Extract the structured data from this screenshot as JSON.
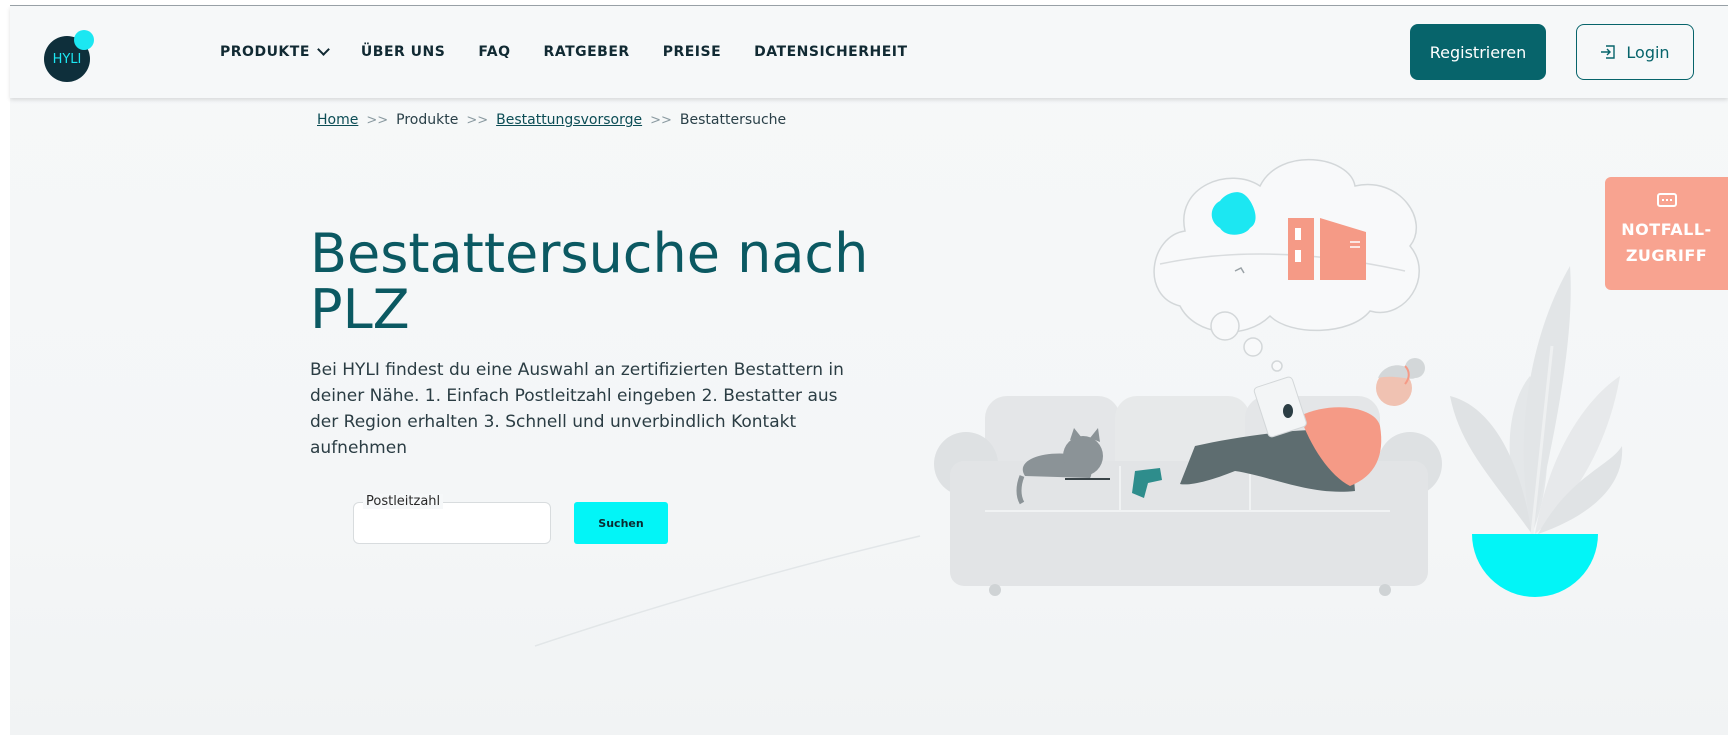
{
  "brand": {
    "logo_text": "HYLI"
  },
  "nav": {
    "items": [
      {
        "label": "PRODUKTE",
        "has_dropdown": true
      },
      {
        "label": "ÜBER UNS"
      },
      {
        "label": "FAQ"
      },
      {
        "label": "RATGEBER"
      },
      {
        "label": "PREISE"
      },
      {
        "label": "DATENSICHERHEIT"
      }
    ]
  },
  "header": {
    "register_label": "Registrieren",
    "login_label": "Login"
  },
  "breadcrumb": {
    "items": [
      "Home",
      "Produkte",
      "Bestattungsvorsorge",
      "Bestattersuche"
    ],
    "separator": ">>"
  },
  "main": {
    "title": "Bestattersuche nach PLZ",
    "intro": "Bei HYLI findest du eine Auswahl an zertifizierten Bestattern in deiner Nähe. 1. Einfach Postleitzahl eingeben 2. Bestatter aus der Region erhalten 3. Schnell und unverbindlich Kontakt aufnehmen",
    "search": {
      "field_label": "Postleitzahl",
      "value": "",
      "button_label": "Suchen"
    }
  },
  "emergency": {
    "line1": "NOTFALL-",
    "line2": "ZUGRIFF"
  },
  "colors": {
    "primary": "#07646b",
    "title": "#0b5962",
    "accent_cyan": "#02f5f7",
    "emergency": "#f8a390",
    "logo_dark": "#0e2f3b"
  }
}
